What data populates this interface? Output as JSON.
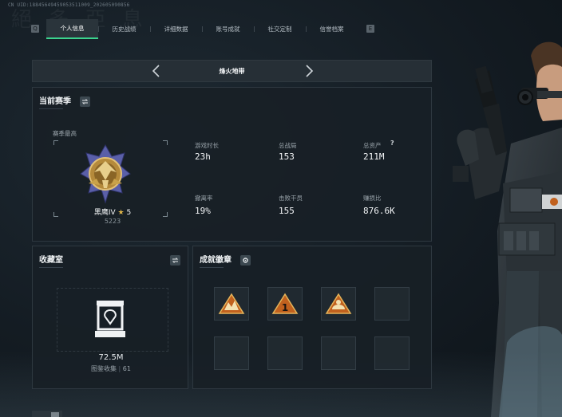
{
  "header": {
    "uid_text": "CN UID:18845649459053511009_202605090856",
    "tabs": [
      {
        "label": "个人信息",
        "active": true
      },
      {
        "label": "历史战绩",
        "active": false
      },
      {
        "label": "详细数据",
        "active": false
      },
      {
        "label": "账号成就",
        "active": false
      },
      {
        "label": "社交定制",
        "active": false
      },
      {
        "label": "信誉档案",
        "active": false
      }
    ],
    "prev_key": "Q",
    "next_key": "E"
  },
  "mode_selector": {
    "label": "烽火地带"
  },
  "season": {
    "title": "当前赛季",
    "highest_label": "赛季最高",
    "rank_name": "黑鹰IV",
    "rank_stars": "5",
    "rank_score": "5223",
    "stats": [
      {
        "label": "游戏时长",
        "value": "23h"
      },
      {
        "label": "总战局",
        "value": "153"
      },
      {
        "label": "总资产",
        "value": "211M",
        "help": "?"
      },
      {
        "label": "撤离率",
        "value": "19%"
      },
      {
        "label": "击败干员",
        "value": "155"
      },
      {
        "label": "赚损比",
        "value": "876.6K"
      }
    ]
  },
  "collection": {
    "title": "收藏室",
    "value": "72.5M",
    "count_label": "图鉴收集",
    "count_value": "61"
  },
  "achievements": {
    "title": "成就徽章",
    "badges": [
      "badge-1",
      "badge-2",
      "badge-3",
      "empty",
      "empty",
      "empty",
      "empty",
      "empty"
    ],
    "badge_number": "1"
  },
  "colors": {
    "accent": "#3bd38e",
    "gold": "#c9a24a",
    "badge_orange": "#c1611e"
  }
}
